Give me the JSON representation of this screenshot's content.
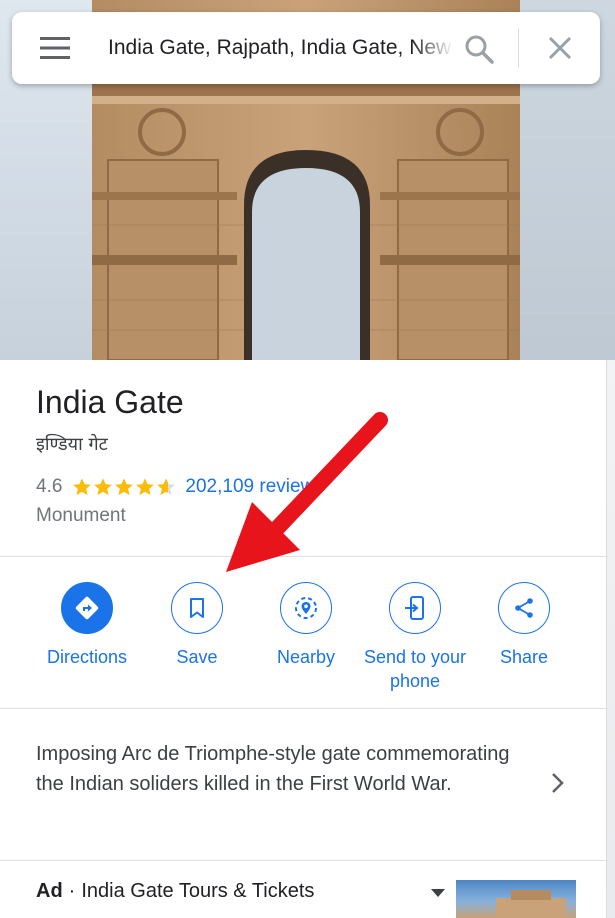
{
  "search": {
    "query": "India Gate, Rajpath, India Gate, New Delhi",
    "icons": [
      "menu-icon",
      "search-icon",
      "close-icon"
    ]
  },
  "place": {
    "name": "India Gate",
    "alt_name": "इण्डिया गेट",
    "rating": "4.6",
    "stars_fraction": 0.92,
    "reviews": "202,109 reviews",
    "category": "Monument"
  },
  "actions": [
    {
      "label": "Directions",
      "icon": "directions-icon"
    },
    {
      "label": "Save",
      "icon": "bookmark-icon"
    },
    {
      "label": "Nearby",
      "icon": "nearby-icon"
    },
    {
      "label": "Send to your phone",
      "icon": "send-to-phone-icon"
    },
    {
      "label": "Share",
      "icon": "share-icon"
    }
  ],
  "description": "Imposing Arc de Triomphe-style gate commemorating the Indian soliders killed in the First World War.",
  "ad": {
    "badge": "Ad",
    "separator": "·",
    "title": "India Gate Tours & Tickets"
  },
  "colors": {
    "accent": "#1a73e8",
    "star": "#fbbc04",
    "annotation": "#e8141b"
  }
}
